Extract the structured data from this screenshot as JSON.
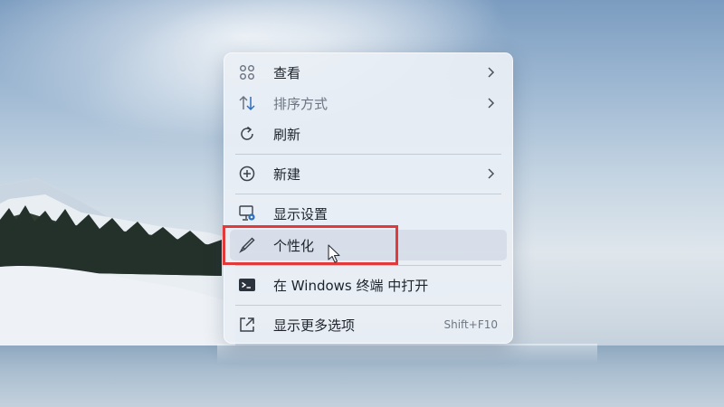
{
  "context_menu": {
    "items": [
      {
        "label": "查看",
        "icon": "grid-view-icon",
        "has_submenu": true
      },
      {
        "label": "排序方式",
        "icon": "sort-arrows-icon",
        "has_submenu": true
      },
      {
        "label": "刷新",
        "icon": "refresh-icon",
        "has_submenu": false
      },
      {
        "label": "新建",
        "icon": "plus-circle-icon",
        "has_submenu": true
      },
      {
        "label": "显示设置",
        "icon": "display-settings-icon",
        "has_submenu": false
      },
      {
        "label": "个性化",
        "icon": "brush-icon",
        "has_submenu": false
      },
      {
        "label": "在 Windows 终端 中打开",
        "icon": "terminal-icon",
        "has_submenu": false
      },
      {
        "label": "显示更多选项",
        "icon": "more-options-icon",
        "has_submenu": false,
        "shortcut": "Shift+F10"
      }
    ]
  },
  "colors": {
    "highlight_border": "#e23a3a",
    "menu_background": "#eaeff5",
    "icon_accent": "#2f6fbf"
  }
}
